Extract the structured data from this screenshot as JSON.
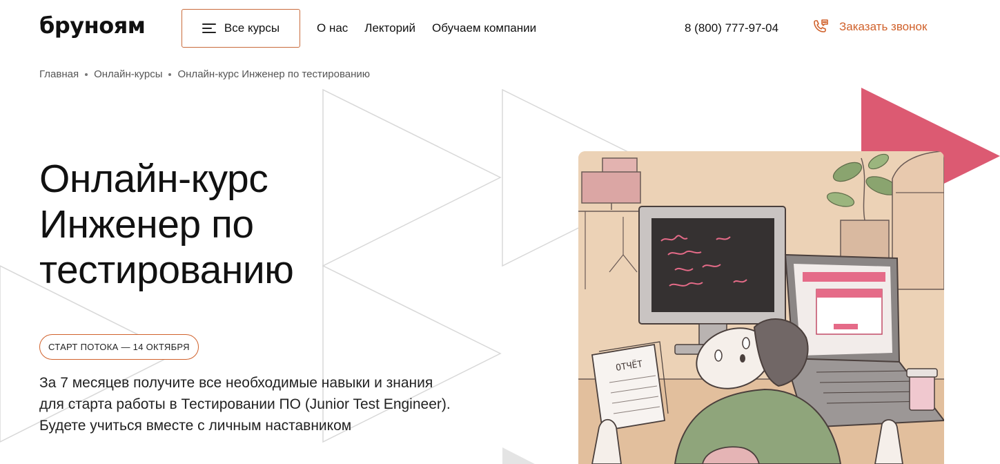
{
  "header": {
    "logo": "бруноям",
    "all_courses_label": "Все курсы",
    "nav": [
      "О нас",
      "Лекторий",
      "Обучаем компании"
    ],
    "phone": "8 (800) 777-97-04",
    "call_label": "Заказать звонок"
  },
  "breadcrumb": [
    "Главная",
    "Онлайн-курсы",
    "Онлайн-курс Инженер по тестированию"
  ],
  "hero": {
    "title_lines": [
      "Онлайн-курс",
      "Инженер по",
      "тестированию"
    ],
    "start_badge": "СТАРТ ПОТОКА — 14 ОКТЯБРЯ",
    "description_lines": [
      "За 7 месяцев получите все необходимые навыки и знания",
      "для старта работы в Тестировании ПО (Junior Test Engineer).",
      "Будете учиться вместе с личным наставником"
    ],
    "illustration_report_text": "ОТЧЁТ"
  },
  "colors": {
    "accent": "#d0612b",
    "pink": "#dc5a72",
    "illustration_bg": "#ecd2b6"
  }
}
